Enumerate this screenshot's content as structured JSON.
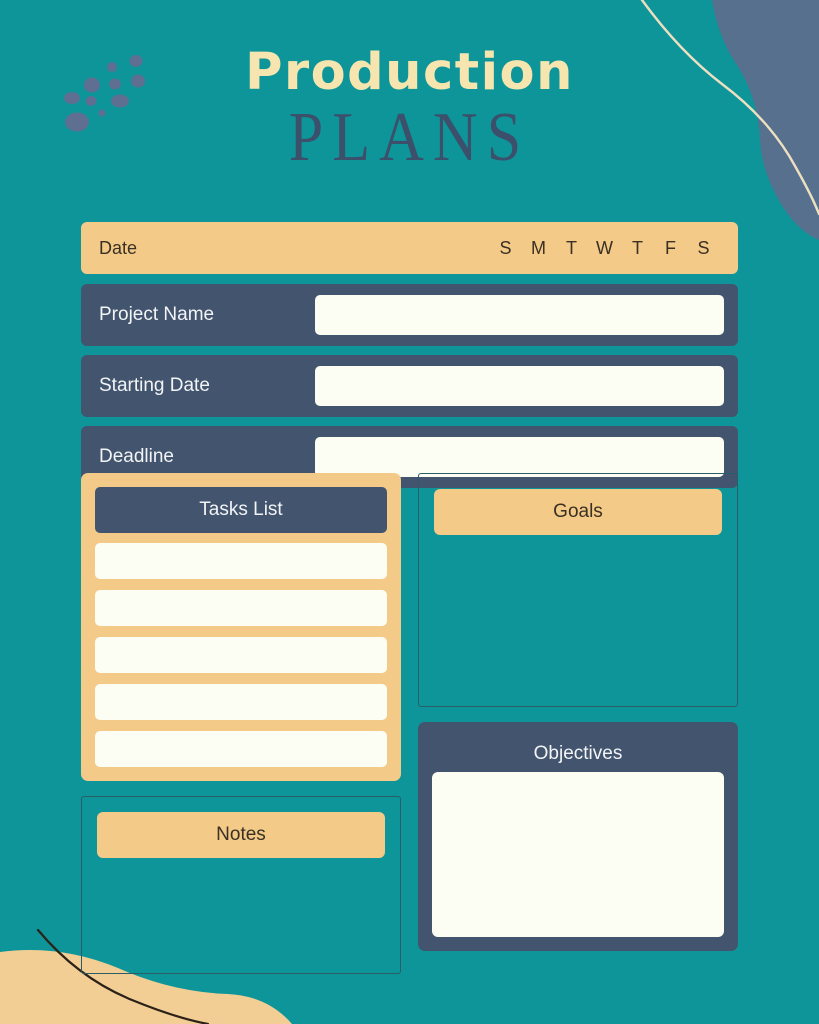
{
  "theme": {
    "background_teal": "#0D9599",
    "tan": "#F3CA87",
    "navy": "#43546E",
    "cream_input": "#FDFEF3",
    "title_cream": "#F6E5AE",
    "dark_text": "#3B3024",
    "slate_blob": "#56708E",
    "tan_blob": "#F2CE94",
    "line_cream": "#EDE0C0",
    "line_dark": "#2B2118",
    "outline": "#2A5D66"
  },
  "header": {
    "title_main": "Production",
    "title_sub": "PLANS"
  },
  "date_row": {
    "label": "Date",
    "days": [
      "S",
      "M",
      "T",
      "W",
      "T",
      "F",
      "S"
    ]
  },
  "fields": [
    {
      "label": "Project Name",
      "value": "",
      "placeholder": ""
    },
    {
      "label": "Starting Date",
      "value": "",
      "placeholder": ""
    },
    {
      "label": "Deadline",
      "value": "",
      "placeholder": ""
    }
  ],
  "tasks": {
    "header": "Tasks List",
    "rows": [
      {
        "value": "",
        "placeholder": ""
      },
      {
        "value": "",
        "placeholder": ""
      },
      {
        "value": "",
        "placeholder": ""
      },
      {
        "value": "",
        "placeholder": ""
      },
      {
        "value": "",
        "placeholder": ""
      }
    ]
  },
  "notes": {
    "header": "Notes",
    "value": "",
    "placeholder": ""
  },
  "goals": {
    "header": "Goals",
    "value": "",
    "placeholder": ""
  },
  "objectives": {
    "header": "Objectives",
    "value": "",
    "placeholder": ""
  },
  "decorations": {
    "dots_icon": "scatter-dots-decoration",
    "top_right_blob": "slate-blob-decoration",
    "top_right_line": "cream-curve-line",
    "bottom_left_blob": "tan-blob-decoration",
    "bottom_left_line": "dark-curve-line"
  }
}
